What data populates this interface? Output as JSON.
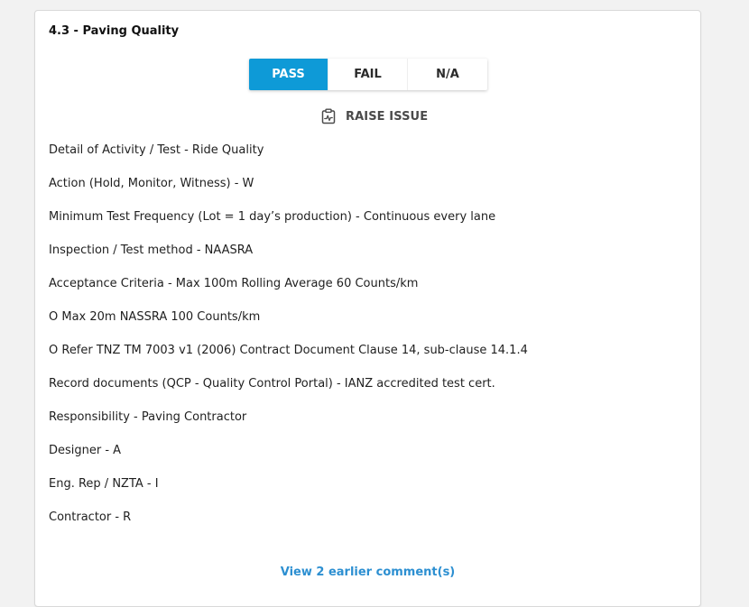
{
  "section": {
    "title": "4.3 - Paving Quality"
  },
  "result_toggle": {
    "options": [
      "PASS",
      "FAIL",
      "N/A"
    ],
    "selected": "PASS",
    "accent_color": "#0e9ad7"
  },
  "raise_issue": {
    "label": "RAISE ISSUE",
    "icon": "clipboard-chart-icon"
  },
  "details": [
    "Detail of Activity / Test - Ride Quality",
    "Action (Hold, Monitor, Witness) - W",
    "Minimum Test Frequency (Lot = 1 day’s production) - Continuous every lane",
    "Inspection / Test method - NAASRA",
    "Acceptance Criteria - Max 100m Rolling Average 60 Counts/km",
    "O Max 20m NASSRA 100 Counts/km",
    "O Refer TNZ TM 7003 v1 (2006) Contract Document Clause 14, sub-clause 14.1.4",
    "Record documents (QCP - Quality Control Portal) - IANZ accredited test cert.",
    "Responsibility - Paving Contractor",
    "Designer - A",
    "Eng. Rep / NZTA - I",
    "Contractor - R"
  ],
  "comments": {
    "link_label": "View 2 earlier comment(s)",
    "link_color": "#2c8fd1"
  }
}
